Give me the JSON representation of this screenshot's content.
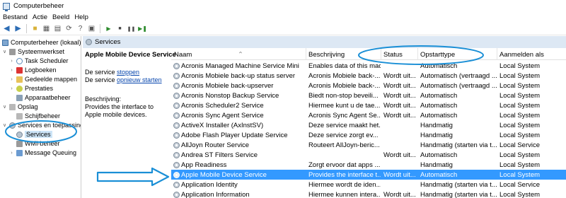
{
  "window": {
    "title": "Computerbeheer"
  },
  "menu": [
    "Bestand",
    "Actie",
    "Beeld",
    "Help"
  ],
  "tree": {
    "root": "Computerbeheer (lokaal)",
    "systeemwerkset": "Systeemwerkset",
    "task_scheduler": "Task Scheduler",
    "logboeken": "Logboeken",
    "gedeelde_mappen": "Gedeelde mappen",
    "prestaties": "Prestaties",
    "apparaatbeheer": "Apparaatbeheer",
    "opslag": "Opslag",
    "schijfbeheer": "Schijfbeheer",
    "services_toepassingen": "Services en toepassingen",
    "services": "Services",
    "wmi": "WMI-beheer",
    "message_queuing": "Message Queuing"
  },
  "pane_header": "Services",
  "description": {
    "service_name": "Apple Mobile Device Service",
    "line1_prefix": "De service ",
    "stop_link": "stoppen",
    "line2_prefix": "De service ",
    "restart_link": "opnieuw starten",
    "desc_label": "Beschrijving:",
    "desc_text_1": "Provides the interface to",
    "desc_text_2": "Apple mobile devices."
  },
  "columns": {
    "name": "Naam",
    "description": "Beschrijving",
    "status": "Status",
    "startup": "Opstarttype",
    "logon": "Aanmelden als"
  },
  "rows": [
    {
      "name": "Acronis Managed Machine Service Mini",
      "desc": "Enables data of this mac...",
      "status": "",
      "startup": "Automatisch",
      "logon": "Local System"
    },
    {
      "name": "Acronis Mobiele back-up status server",
      "desc": "Acronis Mobiele back-...",
      "status": "Wordt uit...",
      "startup": "Automatisch (vertraagd ...",
      "logon": "Local System"
    },
    {
      "name": "Acronis Mobiele back-upserver",
      "desc": "Acronis Mobiele back-...",
      "status": "Wordt uit...",
      "startup": "Automatisch (vertraagd ...",
      "logon": "Local System"
    },
    {
      "name": "Acronis Nonstop Backup Service",
      "desc": "Biedt non-stop beveili...",
      "status": "Wordt uit...",
      "startup": "Automatisch",
      "logon": "Local System"
    },
    {
      "name": "Acronis Scheduler2 Service",
      "desc": "Hiermee kunt u de tae...",
      "status": "Wordt uit...",
      "startup": "Automatisch",
      "logon": "Local System"
    },
    {
      "name": "Acronis Sync Agent Service",
      "desc": "Acronis Sync Agent Se...",
      "status": "Wordt uit...",
      "startup": "Automatisch",
      "logon": "Local System"
    },
    {
      "name": "ActiveX Installer (AxInstSV)",
      "desc": "Deze service maakt het...",
      "status": "",
      "startup": "Handmatig",
      "logon": "Local System"
    },
    {
      "name": "Adobe Flash Player Update Service",
      "desc": "Deze service zorgt ev...",
      "status": "",
      "startup": "Handmatig",
      "logon": "Local System"
    },
    {
      "name": "AllJoyn Router Service",
      "desc": "Routeert AllJoyn-beric...",
      "status": "",
      "startup": "Handmatig (starten via t...",
      "logon": "Local Service"
    },
    {
      "name": "Andrea ST Filters Service",
      "desc": "",
      "status": "Wordt uit...",
      "startup": "Automatisch",
      "logon": "Local System"
    },
    {
      "name": "App Readiness",
      "desc": "Zorgt ervoor dat apps ...",
      "status": "",
      "startup": "Handmatig",
      "logon": "Local System"
    },
    {
      "name": "Apple Mobile Device Service",
      "desc": "Provides the interface t...",
      "status": "Wordt uit...",
      "startup": "Automatisch",
      "logon": "Local System"
    },
    {
      "name": "Application Identity",
      "desc": "Hiermee wordt de iden...",
      "status": "",
      "startup": "Handmatig (starten via t...",
      "logon": "Local Service"
    },
    {
      "name": "Application Information",
      "desc": "Hiermee kunnen intera...",
      "status": "Wordt uit...",
      "startup": "Handmatig (starten via t...",
      "logon": "Local System"
    }
  ],
  "selected_row_index": 11,
  "colors": {
    "selection": "#3399ff",
    "annotation": "#1a8fd6",
    "pane_header": "#dde8f4"
  }
}
